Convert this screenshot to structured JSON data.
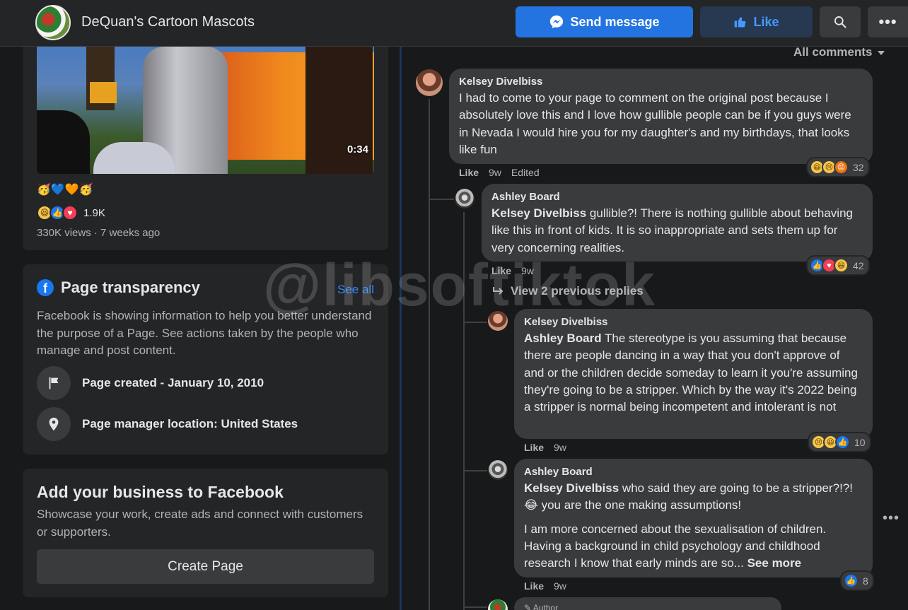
{
  "header": {
    "page_name": "DeQuan's Cartoon Mascots",
    "send_message_label": "Send message",
    "like_label": "Like"
  },
  "video_post": {
    "duration": "0:34",
    "caption_emojis": "🥳💙🧡🥳",
    "reaction_count": "1.9K",
    "views_meta": "330K views · 7 weeks ago"
  },
  "transparency": {
    "title": "Page transparency",
    "see_all": "See all",
    "description": "Facebook is showing information to help you better understand the purpose of a Page. See actions taken by the people who manage and post content.",
    "page_created": "Page created - January 10, 2010",
    "manager_location": "Page manager location: United States"
  },
  "business": {
    "title": "Add your business to Facebook",
    "description": "Showcase your work, create ads and connect with customers or supporters.",
    "create_label": "Create Page"
  },
  "comments": {
    "filter_label": "All comments",
    "view_previous": "View 2 previous replies",
    "items": [
      {
        "author": "Kelsey Divelbiss",
        "mention": "",
        "text": "I had to come to your page to comment on the original post because I absolutely love this and I love how gullible people can be if you guys were in Nevada I would hire you for my daughter's and my birthdays, that looks like fun",
        "like": "Like",
        "time": "9w",
        "edited": "Edited",
        "reaction_count": "32"
      },
      {
        "author": "Ashley Board",
        "mention": "Kelsey Divelbiss",
        "text": " gullible?! There is nothing gullible about behaving like this in front of kids. It is so inappropriate and sets them up for very concerning realities.",
        "like": "Like",
        "time": "9w",
        "reaction_count": "42"
      },
      {
        "author": "Kelsey Divelbiss",
        "mention": "Ashley Board",
        "text": " The stereotype is you assuming that because there are people dancing in a way that you don't approve of and or the children decide someday to learn it you're assuming they're going to be a stripper. Which by the way it's 2022 being a stripper is normal being incompetent and intolerant is not",
        "like": "Like",
        "time": "9w",
        "reaction_count": "10"
      },
      {
        "author": "Ashley Board",
        "mention": "Kelsey Divelbiss",
        "text": " who said they are going to be a stripper?!?! 😂 you are the one making assumptions!",
        "text2": "I am more concerned about the sexualisation of children. Having a background in child psychology and childhood research I know that early minds are so...",
        "see_more": "See more",
        "like": "Like",
        "time": "9w",
        "reaction_count": "8"
      }
    ],
    "author_chip": "Author"
  },
  "watermark": "@libsoftiktok"
}
